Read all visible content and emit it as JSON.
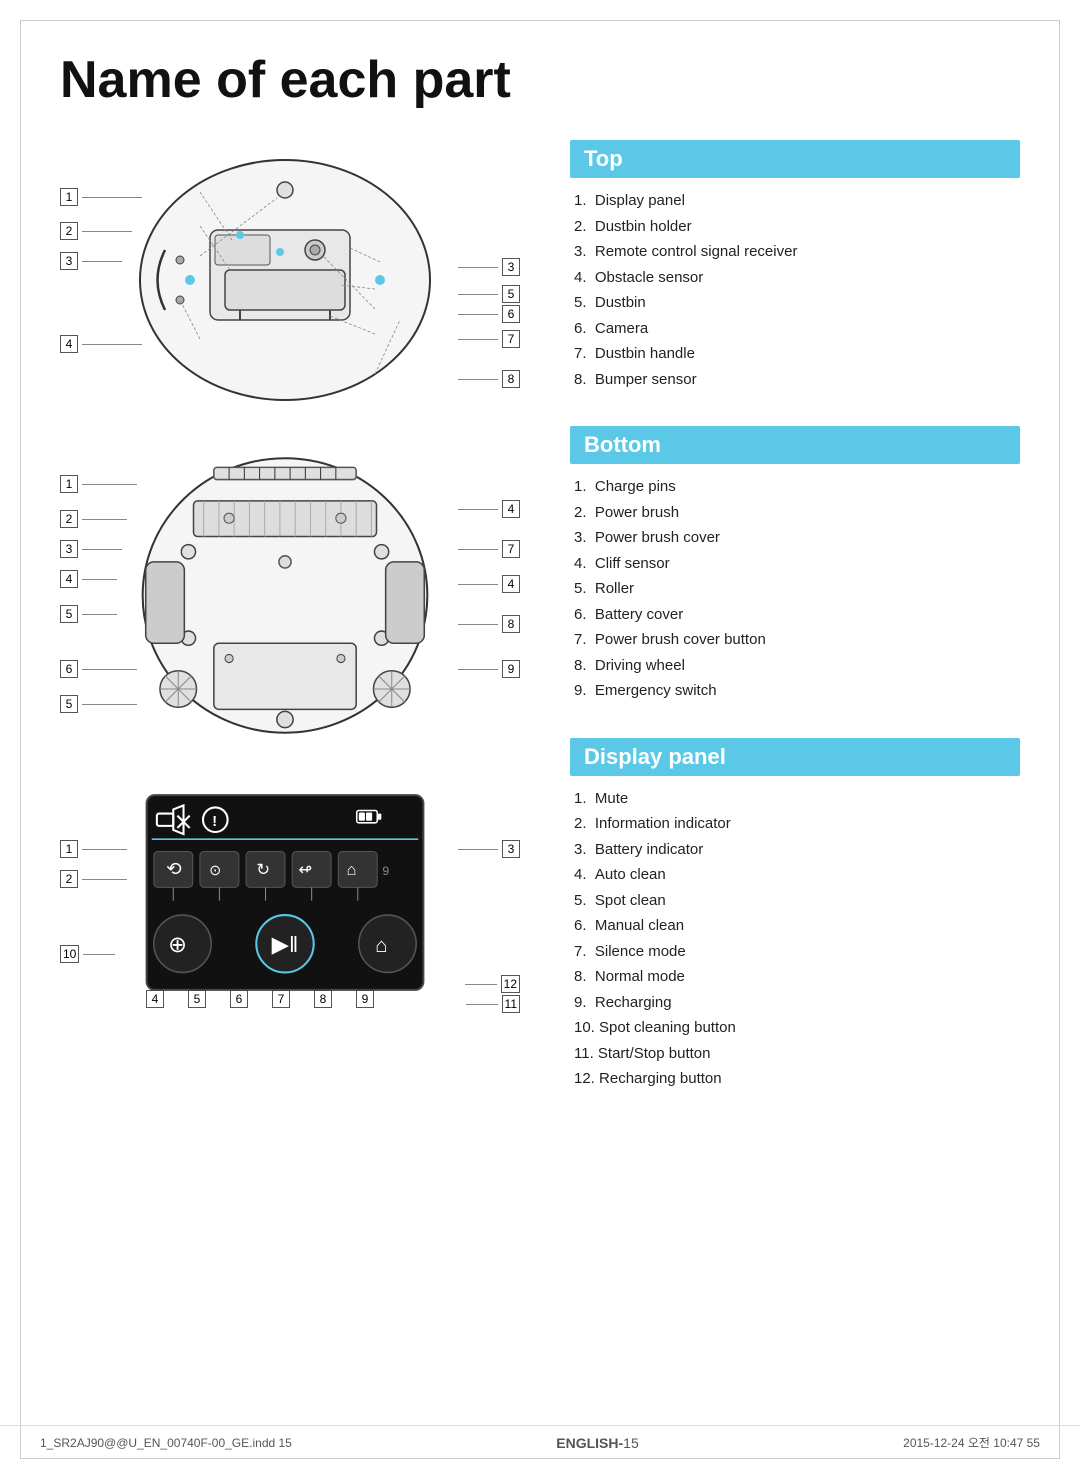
{
  "title": "Name of each part",
  "sections": {
    "top": {
      "header": "Top",
      "items": [
        "Display panel",
        "Dustbin holder",
        "Remote control signal receiver",
        "Obstacle sensor",
        "Dustbin",
        "Camera",
        "Dustbin handle",
        "Bumper sensor"
      ]
    },
    "bottom": {
      "header": "Bottom",
      "items": [
        "Charge pins",
        "Power brush",
        "Power brush cover",
        "Cliff sensor",
        "Roller",
        "Battery cover",
        "Power brush cover button",
        "Driving wheel",
        "Emergency switch"
      ]
    },
    "display": {
      "header": "Display panel",
      "items": [
        "Mute",
        "Information indicator",
        "Battery indicator",
        "Auto clean",
        "Spot clean",
        "Manual clean",
        "Silence mode",
        "Normal mode",
        "Recharging",
        "Spot cleaning button",
        "Start/Stop button",
        "Recharging button"
      ]
    }
  },
  "footer": {
    "left": "1_SR2AJ90@@U_EN_00740F-00_GE.indd  15",
    "middle": "ENGLISH-15",
    "right": "2015-12-24  오전 10:47  55"
  }
}
